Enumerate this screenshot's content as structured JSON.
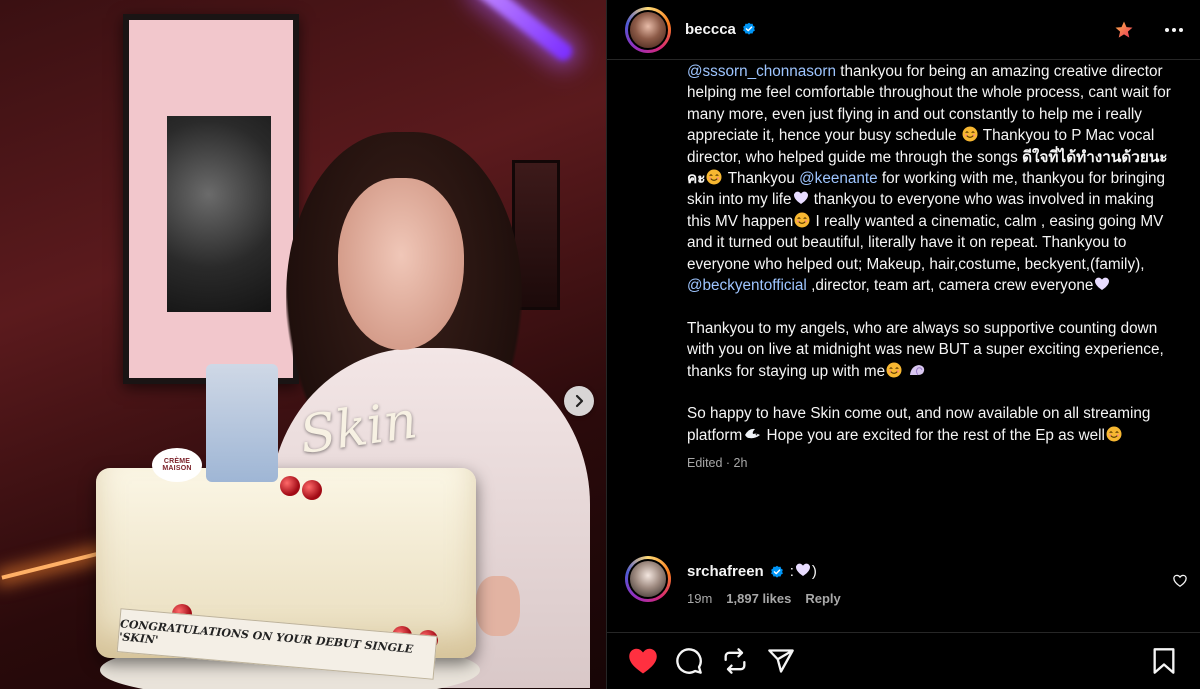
{
  "post": {
    "author": "beccca",
    "verified": true,
    "time_label": "Edited · 2h",
    "photo": {
      "cake_script": "Skin",
      "cake_badge": "CRÈME MAISON",
      "cake_ribbon": "CONGRATULATIONS ON YOUR DEBUT SINGLE 'SKIN'"
    }
  },
  "caption": {
    "paragraph1": [
      {
        "type": "mention",
        "text": "@sssorn_chonnasorn"
      },
      {
        "type": "text",
        "text": " thankyou for being an amazing creative director helping me feel comfortable throughout the whole process, cant wait for many more, even just flying in and out constantly to help me i really appreciate it, hence your busy schedule "
      },
      {
        "type": "emoji",
        "name": "smile"
      },
      {
        "type": "text",
        "text": " Thankyou to P Mac vocal director, who helped guide me through the songs "
      },
      {
        "type": "thai",
        "text": "ดีใจที่ได้ทำงานด้วยนะคะ"
      },
      {
        "type": "emoji",
        "name": "smile"
      },
      {
        "type": "text",
        "text": " Thankyou "
      },
      {
        "type": "mention",
        "text": "@keenante"
      },
      {
        "type": "text",
        "text": " for working with me, thankyou for bringing skin into my life"
      },
      {
        "type": "emoji",
        "name": "heart"
      },
      {
        "type": "text",
        "text": " thankyou to everyone who was involved in making this MV happen"
      },
      {
        "type": "emoji",
        "name": "smile"
      },
      {
        "type": "text",
        "text": " I really wanted a cinematic, calm , easing going MV and it turned out beautiful, literally have it on repeat. Thankyou to everyone who helped out; Makeup, hair,costume, beckyent,(family), "
      },
      {
        "type": "mention",
        "text": "@beckyentofficial"
      },
      {
        "type": "text",
        "text": " ,director, team art, camera crew everyone"
      },
      {
        "type": "emoji",
        "name": "heart"
      }
    ],
    "paragraph2": [
      {
        "type": "text",
        "text": "Thankyou to my angels, who are always so supportive counting down with you on live at midnight was new BUT a super exciting experience, thanks for staying up with me"
      },
      {
        "type": "emoji",
        "name": "smile"
      },
      {
        "type": "text",
        "text": " "
      },
      {
        "type": "emoji",
        "name": "shell"
      }
    ],
    "paragraph3": [
      {
        "type": "text",
        "text": "So happy to have Skin come out, and now available on all streaming platform"
      },
      {
        "type": "emoji",
        "name": "dove"
      },
      {
        "type": "text",
        "text": " Hope you are excited for the rest of the Ep as well"
      },
      {
        "type": "emoji",
        "name": "smile"
      }
    ]
  },
  "comment": {
    "username": "srchafreen",
    "verified": true,
    "text": ":",
    "text_after": ")",
    "time": "19m",
    "likes": "1,897 likes",
    "reply_label": "Reply"
  },
  "icons": {
    "verified": "verified-badge-icon",
    "favorite": "star-icon",
    "more": "more-horizontal-icon",
    "next": "chevron-right-icon",
    "like": "heart-icon",
    "comment": "comment-bubble-icon",
    "repost": "repost-icon",
    "share": "send-icon",
    "save": "bookmark-icon"
  },
  "colors": {
    "like_red": "#ff3040",
    "mention_blue": "#9ec5ff",
    "verified_blue": "#0095f6",
    "favorite_star": "#f06a4a"
  }
}
